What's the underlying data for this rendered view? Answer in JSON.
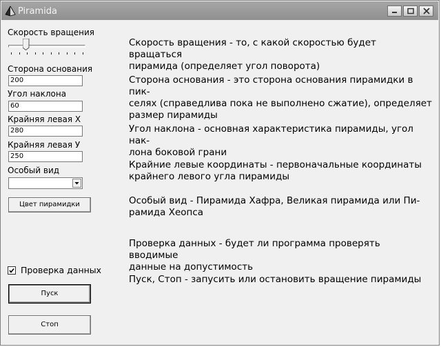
{
  "window": {
    "title": "Piramida"
  },
  "controls": {
    "speed_label": "Скорость вращения",
    "speed_value": 0.2,
    "side_label": "Сторона основания",
    "side_value": "200",
    "angle_label": "Угол наклона",
    "angle_value": "60",
    "left_x_label": "Крайняя левая X",
    "left_x_value": "280",
    "left_y_label": "Крайняя левая У",
    "left_y_value": "250",
    "special_label": "Особый вид",
    "special_value": "",
    "color_button": "Цвет пирамидки",
    "check_label": "Проверка данных",
    "check_checked": true,
    "start_button": "Пуск",
    "stop_button": "Стоп"
  },
  "help": [
    "Скорость вращения - то, с какой скоростью будет вращаться\nпирамида (определяет угол поворота)",
    "Сторона основания - это сторона основания пирамидки в пик-\nселях (справедлива пока не выполнено сжатие), определяет\nразмер пирамиды",
    "Угол наклона - основная характеристика пирамиды, угол нак-\nлона боковой грани",
    "Крайние левые координаты - первоначальные координаты\nкрайнего левого угла пирамиды",
    "Особый вид - Пирамида Хафра, Великая пирамида или Пи-\nрамида Хеопса",
    "Проверка данных - будет ли программа проверять вводимые\nданные на допустимость",
    "Пуск, Стоп - запусить или остановить вращение пирамиды"
  ],
  "icons": {
    "app": "pyramid-icon",
    "minimize": "minimize-icon",
    "maximize": "maximize-icon",
    "close": "close-icon",
    "dropdown": "chevron-down-icon",
    "check": "checkmark-icon"
  }
}
